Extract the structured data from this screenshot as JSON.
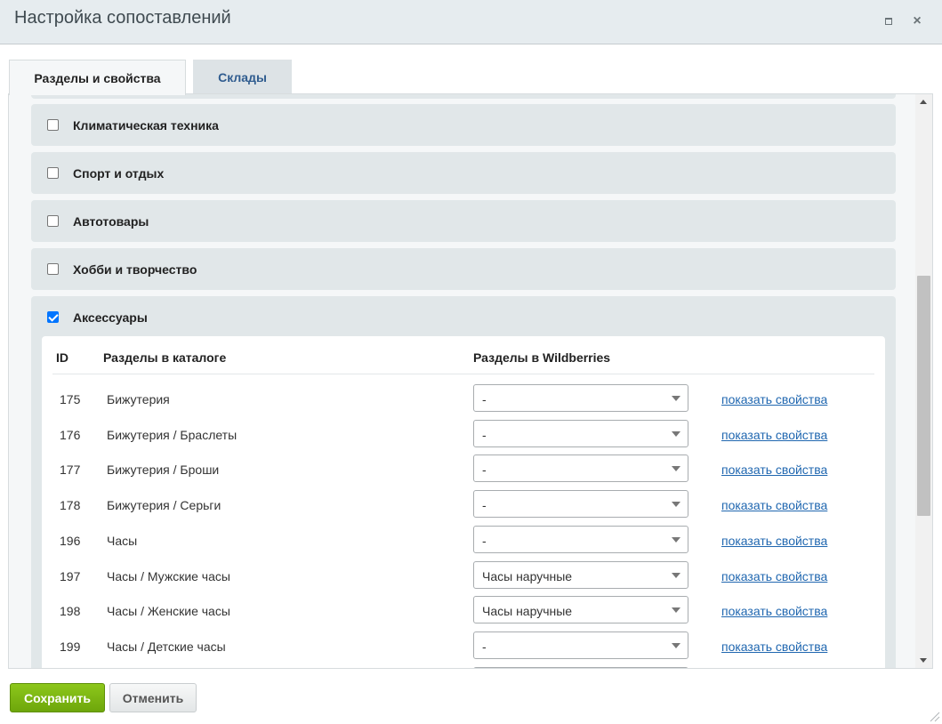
{
  "window": {
    "title": "Настройка сопоставлений",
    "maximize_icon": "maximize-icon",
    "close_icon": "close-icon",
    "close_glyph": "×"
  },
  "tabs": [
    {
      "label": "Разделы и свойства",
      "active": true
    },
    {
      "label": "Склады",
      "active": false
    }
  ],
  "sections": [
    {
      "label": "Климатическая техника",
      "checked": false
    },
    {
      "label": "Спорт и отдых",
      "checked": false
    },
    {
      "label": "Автотовары",
      "checked": false
    },
    {
      "label": "Хобби и творчество",
      "checked": false
    },
    {
      "label": "Аксессуары",
      "checked": true
    }
  ],
  "table": {
    "headers": {
      "id": "ID",
      "catalog": "Разделы в каталоге",
      "wildberries": "Разделы в Wildberries"
    },
    "rows": [
      {
        "id": "175",
        "name": "Бижутерия",
        "wb": "-",
        "link": "показать свойства"
      },
      {
        "id": "176",
        "name": "Бижутерия / Браслеты",
        "wb": "-",
        "link": "показать свойства"
      },
      {
        "id": "177",
        "name": "Бижутерия / Броши",
        "wb": "-",
        "link": "показать свойства"
      },
      {
        "id": "178",
        "name": "Бижутерия / Серьги",
        "wb": "-",
        "link": "показать свойства"
      },
      {
        "id": "196",
        "name": "Часы",
        "wb": "-",
        "link": "показать свойства"
      },
      {
        "id": "197",
        "name": "Часы / Мужские часы",
        "wb": "Часы наручные",
        "link": "показать свойства"
      },
      {
        "id": "198",
        "name": "Часы / Женские часы",
        "wb": "Часы наручные",
        "link": "показать свойства"
      },
      {
        "id": "199",
        "name": "Часы / Детские часы",
        "wb": "-",
        "link": "показать свойства"
      }
    ]
  },
  "footer": {
    "save_label": "Сохранить",
    "cancel_label": "Отменить"
  },
  "colors": {
    "accent_green": "#7ab712",
    "link_blue": "#2067b0",
    "checkbox_blue": "#0075ff"
  }
}
